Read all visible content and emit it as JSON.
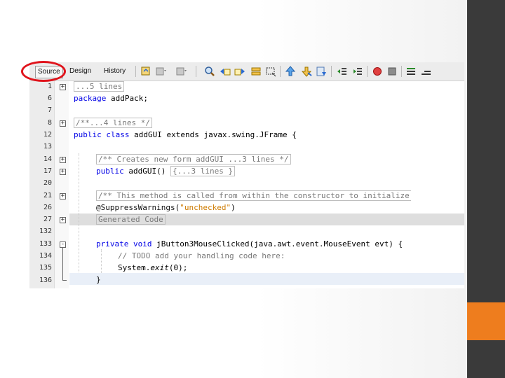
{
  "editor": {
    "tabs": {
      "source": "Source",
      "design": "Design",
      "history": "History"
    },
    "toolbar_icons": [
      "last-edit-icon",
      "back-icon",
      "forward-icon",
      "find-icon",
      "find-previous-icon",
      "find-next-icon",
      "toggle-highlight-icon",
      "toggle-rect-select-icon",
      "prev-bookmark-icon",
      "next-bookmark-icon",
      "toggle-bookmark-icon",
      "shift-left-icon",
      "shift-right-icon",
      "macro-record-icon",
      "macro-stop-icon",
      "comment-icon",
      "uncomment-icon"
    ],
    "lines": [
      {
        "number": "1",
        "fold": "+",
        "text": "...5 lines"
      },
      {
        "number": "6",
        "fold": "",
        "keyword": "package",
        "text": " addPack;"
      },
      {
        "number": "7",
        "fold": "",
        "text": ""
      },
      {
        "number": "8",
        "fold": "+",
        "text": "/**...4 lines */"
      },
      {
        "number": "12",
        "fold": "",
        "keyword": "public class",
        "text": " addGUI extends javax.swing.JFrame {"
      },
      {
        "number": "13",
        "fold": "",
        "text": ""
      },
      {
        "number": "14",
        "fold": "+",
        "text": "/** Creates new form addGUI ...3 lines */"
      },
      {
        "number": "17",
        "fold": "+",
        "keyword": "public",
        "text": " addGUI() ",
        "extra": "{...3 lines }"
      },
      {
        "number": "20",
        "fold": "",
        "text": ""
      },
      {
        "number": "21",
        "fold": "+",
        "text": "/** This method is called from within the constructor to initialize"
      },
      {
        "number": "26",
        "fold": "",
        "annotation": "@SuppressWarnings(",
        "string": "\"unchecked\"",
        "close": ")"
      },
      {
        "number": "27",
        "fold": "+",
        "text": "Generated Code"
      },
      {
        "number": "132",
        "fold": "",
        "text": ""
      },
      {
        "number": "133",
        "fold": "-",
        "keyword": "private void",
        "text": " jButton3MouseClicked(java.awt.event.MouseEvent evt) {"
      },
      {
        "number": "134",
        "fold": "",
        "text": "// TODO add your handling code here:"
      },
      {
        "number": "135",
        "fold": "",
        "text": "System.",
        "italic": "exit",
        "tail": "(0);"
      },
      {
        "number": "136",
        "fold": "",
        "text": "}"
      }
    ]
  }
}
